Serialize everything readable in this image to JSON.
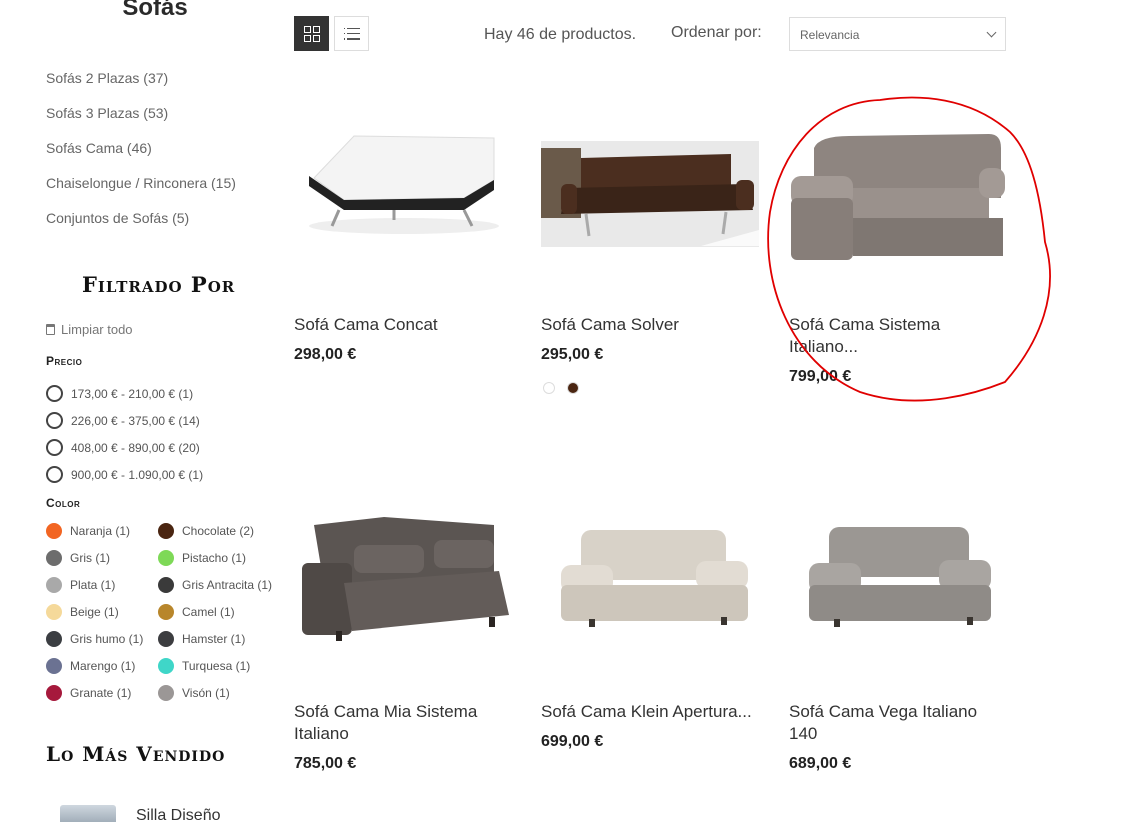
{
  "sidebar": {
    "title": "Sofás",
    "categories": [
      "Sofás 2 Plazas (37)",
      "Sofás 3 Plazas (53)",
      "Sofás Cama (46)",
      "Chaiselongue / Rinconera (15)",
      "Conjuntos de Sofás (5)"
    ],
    "filter_heading": "Filtrado Por",
    "clear_all": "Limpiar todo",
    "price_title": "Precio",
    "prices": [
      "173,00 € - 210,00 € (1)",
      "226,00 € - 375,00 € (14)",
      "408,00 € - 890,00 € (20)",
      "900,00 € - 1.090,00 € (1)"
    ],
    "color_title": "Color",
    "colors": [
      {
        "label": "Naranja (1)",
        "color": "#f26522"
      },
      {
        "label": "Chocolate (2)",
        "color": "#4a2511"
      },
      {
        "label": "Gris (1)",
        "color": "#6d6d6d"
      },
      {
        "label": "Pistacho (1)",
        "color": "#7ed957"
      },
      {
        "label": "Plata (1)",
        "color": "#a9a9a9"
      },
      {
        "label": "Gris Antracita (1)",
        "color": "#3a3a3a"
      },
      {
        "label": "Beige (1)",
        "color": "#f5d99a"
      },
      {
        "label": "Camel (1)",
        "color": "#b8862b"
      },
      {
        "label": "Gris humo (1)",
        "color": "#3b3e42"
      },
      {
        "label": "Hamster (1)",
        "color": "#3c3d40"
      },
      {
        "label": "Marengo (1)",
        "color": "#6b7292"
      },
      {
        "label": "Turquesa (1)",
        "color": "#3fd6c8"
      },
      {
        "label": "Granate (1)",
        "color": "#a6193c"
      },
      {
        "label": "Visón (1)",
        "color": "#9b9796"
      }
    ],
    "best_heading": "Lo Más Vendido",
    "best_item": "Silla Diseño"
  },
  "toolbar": {
    "count": "Hay 46 de productos.",
    "sort_label": "Ordenar por:",
    "sort_value": "Relevancia"
  },
  "products": [
    {
      "name": "Sofá Cama Concat",
      "price": "298,00 €"
    },
    {
      "name": "Sofá Cama Solver",
      "price": "295,00 €",
      "swatches": [
        "#ffffff",
        "#4a2511"
      ]
    },
    {
      "name": "Sofá Cama Sistema Italiano...",
      "price": "799,00 €"
    },
    {
      "name": "Sofá Cama Mia Sistema Italiano",
      "price": "785,00 €"
    },
    {
      "name": "Sofá Cama Klein Apertura...",
      "price": "699,00 €"
    },
    {
      "name": "Sofá Cama Vega Italiano 140",
      "price": "689,00 €"
    }
  ]
}
